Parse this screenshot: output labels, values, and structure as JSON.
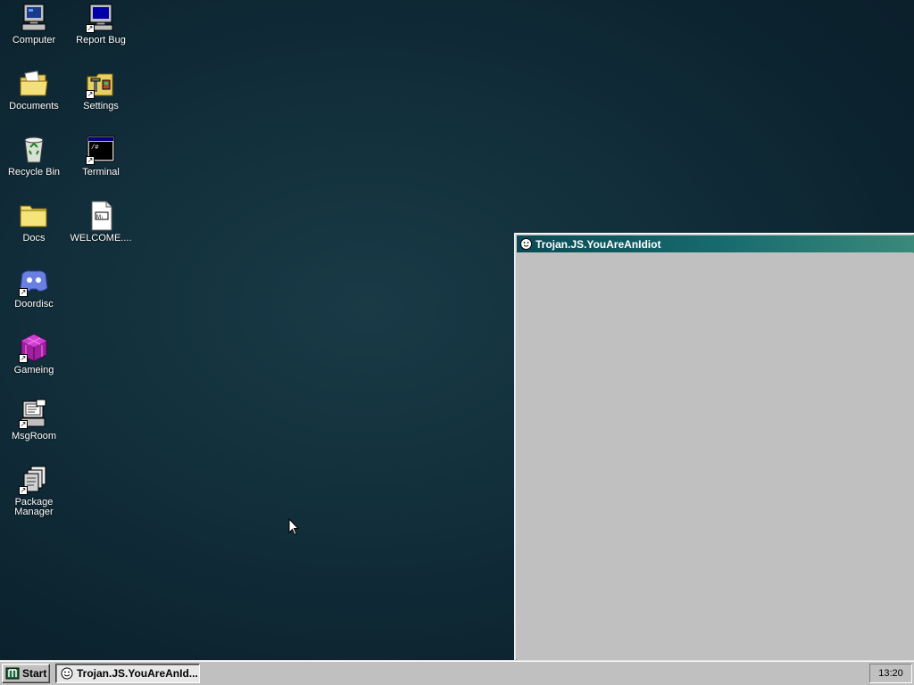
{
  "desktop": {
    "icons": [
      {
        "label": "Computer",
        "icon": "computer-icon"
      },
      {
        "label": "Report Bug",
        "icon": "report-bug-icon"
      },
      {
        "label": "Documents",
        "icon": "documents-folder-icon"
      },
      {
        "label": "Settings",
        "icon": "settings-icon"
      },
      {
        "label": "Recycle Bin",
        "icon": "recycle-bin-icon"
      },
      {
        "label": "Terminal",
        "icon": "terminal-icon"
      },
      {
        "label": "Docs",
        "icon": "folder-icon"
      },
      {
        "label": "WELCOME....",
        "icon": "markdown-file-icon"
      },
      {
        "label": "Doordisc",
        "icon": "doordisc-icon"
      },
      {
        "label": "Gameing",
        "icon": "gameing-icon"
      },
      {
        "label": "MsgRoom",
        "icon": "msgroom-icon"
      },
      {
        "label": "Package Manager",
        "icon": "package-manager-icon"
      }
    ]
  },
  "window": {
    "title": "Trojan.JS.YouAreAnIdiot",
    "icon": "smiley-icon"
  },
  "taskbar": {
    "start_label": "Start",
    "task_label": "Trojan.JS.YouAreAnId...",
    "clock": "13:20"
  },
  "colors": {
    "desktop_bg": "#12303c",
    "titlebar": "#166a6e",
    "window_bg": "#c0c0c0"
  }
}
